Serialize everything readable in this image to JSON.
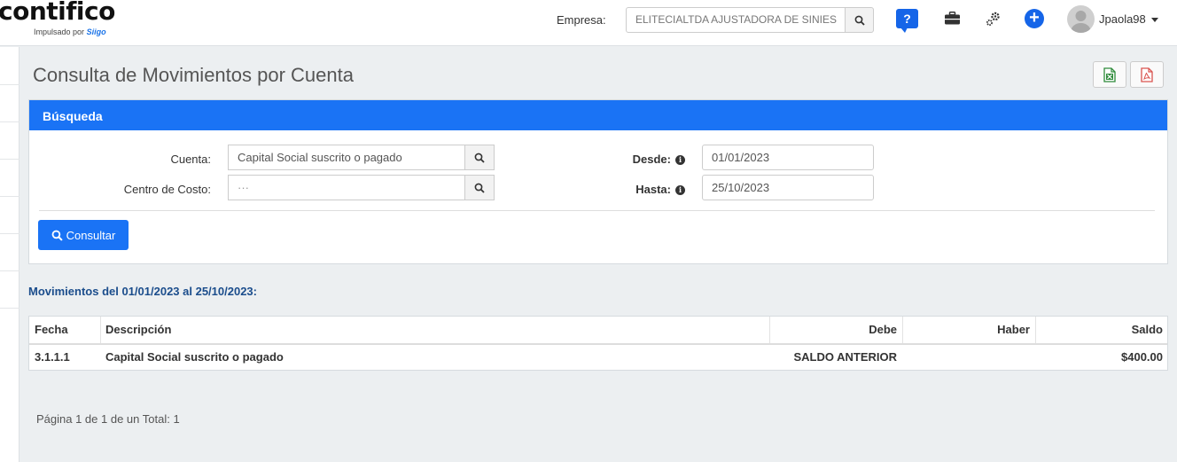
{
  "header": {
    "logo_text": "contifico",
    "logo_tagline_prefix": "Impulsado por",
    "logo_tagline_brand": "Siigo",
    "empresa_label": "Empresa:",
    "empresa_value": "ELITECIALTDA AJUSTADORA DE SINIES",
    "help_glyph": "?",
    "user_name": "Jpaola98",
    "icons": [
      "search-icon",
      "help-icon",
      "briefcase-icon",
      "gears-icon",
      "plus-circle-icon",
      "avatar",
      "caret-down-icon"
    ]
  },
  "page": {
    "title": "Consulta de Movimientos por Cuenta",
    "export_buttons": [
      "excel-icon",
      "pdf-icon"
    ]
  },
  "search_panel": {
    "heading": "Búsqueda",
    "cuenta_label": "Cuenta:",
    "cuenta_value": "Capital Social suscrito o pagado",
    "centro_label": "Centro de Costo:",
    "centro_value": "···",
    "desde_label": "Desde:",
    "desde_value": "01/01/2023",
    "hasta_label": "Hasta:",
    "hasta_value": "25/10/2023",
    "consultar_label": "Consultar"
  },
  "results": {
    "title": "Movimientos del 01/01/2023 al 25/10/2023:",
    "columns": [
      "Fecha",
      "Descripción",
      "Debe",
      "Haber",
      "Saldo"
    ],
    "rows": [
      {
        "fecha": "3.1.1.1",
        "descripcion": "Capital Social suscrito o pagado",
        "debe": "SALDO ANTERIOR",
        "haber": "",
        "saldo": "$400.00"
      }
    ],
    "pagination": "Página 1 de 1 de un Total: 1"
  },
  "colors": {
    "primary": "#1a73f5",
    "accent_title": "#1b4d8c",
    "excel": "#2e8b3a",
    "pdf": "#d9534f"
  }
}
